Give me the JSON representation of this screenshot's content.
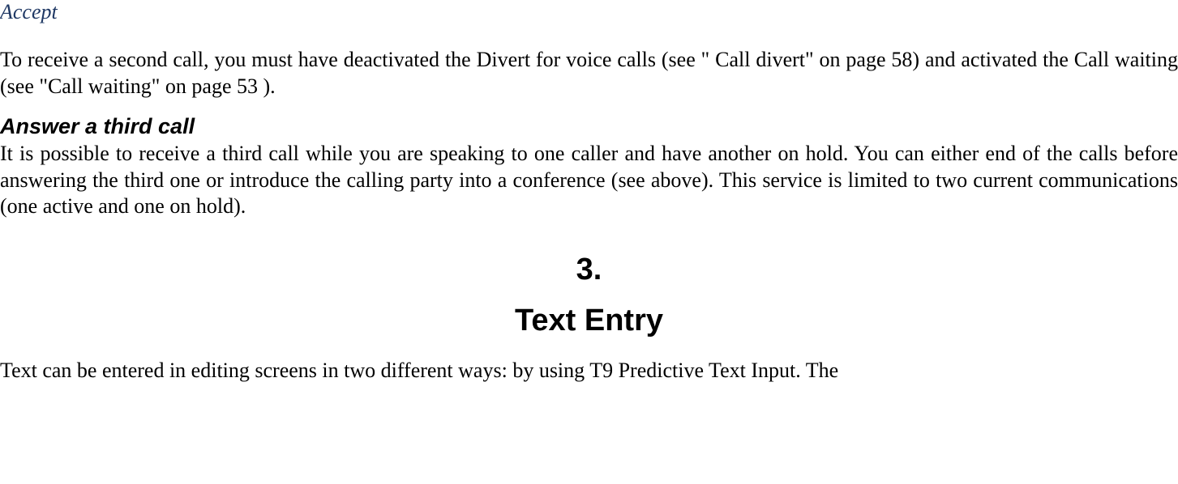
{
  "accept_label": "Accept",
  "para_accept": "To receive a second call, you must have deactivated the Divert for voice calls (see \" Call divert\"  on page  58) and activated the Call waiting (see \"Call waiting\" on page 53 ).",
  "subheading_third": "Answer a third call",
  "para_third": "It is possible to receive a third call while you are speaking to one caller and have another on hold. You can either end of the calls before answering the third one or introduce the calling party into a conference (see above). This service is limited to two current communications (one active and one on hold).",
  "chapter_number": "3.",
  "chapter_title": "Text Entry",
  "para_text_entry": "Text can be entered in editing screens in two different ways: by using T9 Predictive Text Input. The"
}
